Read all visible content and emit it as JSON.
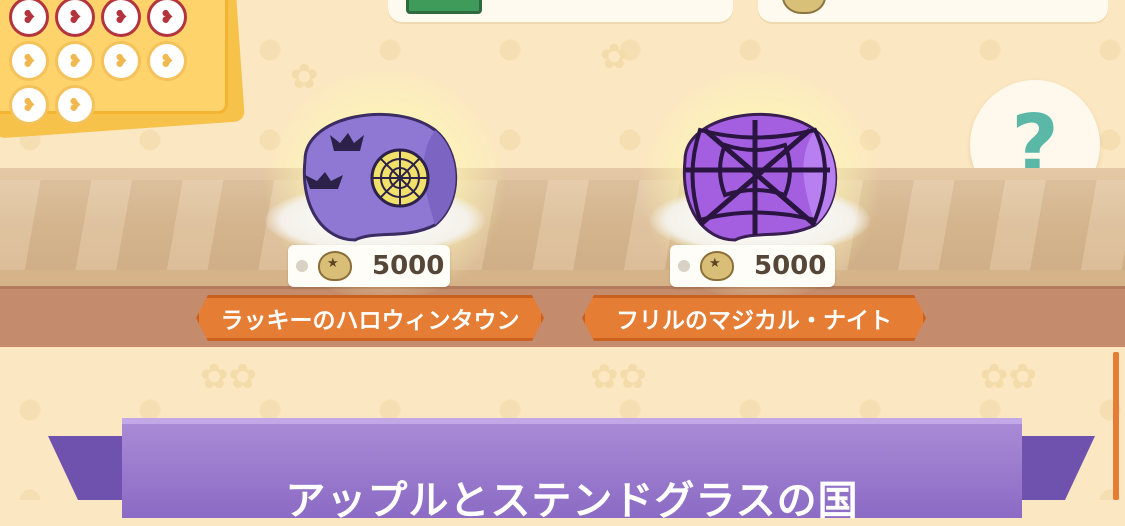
{
  "stamp_card": {
    "filled": 4,
    "total": 10
  },
  "header": {
    "cash_value": "",
    "bells_value": ""
  },
  "help": {
    "label": "?"
  },
  "items": [
    {
      "price": "5000",
      "name": "ラッキーのハロウィンタウン",
      "cookie": "bat-cookie-icon"
    },
    {
      "price": "5000",
      "name": "フリルのマジカル・ナイト",
      "cookie": "web-cookie-icon"
    }
  ],
  "section": {
    "title": "アップルとステンドグラスの国"
  },
  "colors": {
    "banner": "#e67d35",
    "ribbon": "#8b6bc4",
    "help_mark": "#5bb8a6",
    "background": "#fbe7c2"
  }
}
